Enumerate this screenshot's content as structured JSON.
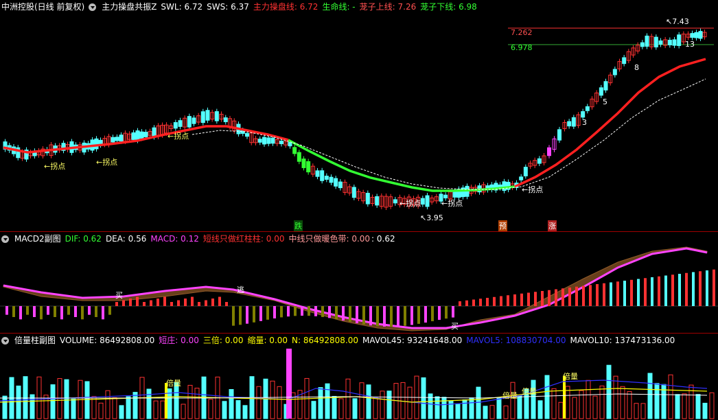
{
  "colors": {
    "up": "#ff3232",
    "down": "#54ffff",
    "ma": "#ff2020",
    "life_green": "#33ff33",
    "white": "#ffffff",
    "magenta": "#ff44ff",
    "yellow": "#ffff00",
    "cyan": "#54ffff",
    "blue": "#3030ff",
    "olive": "#808000"
  },
  "main": {
    "stock": "中洲控股(日线 前复权)",
    "indicator": "主力操盘共振Z",
    "swl": "SWL: 6.72",
    "sws": "SWS: 6.37",
    "zhuli": "主力操盘线: 6.72",
    "shengming": "生命线: -",
    "shangxian": "茏子上线: 7.26",
    "xiaxian": "茏子下线: 6.98",
    "line_up": "7.262",
    "line_down": "6.978",
    "high": "7.43",
    "low": "3.95",
    "count3": "3",
    "count5": "5",
    "count8": "8",
    "count13": "13",
    "guaidian": "拐点",
    "die": "跌",
    "yu": "预",
    "zhang": "涨"
  },
  "macd": {
    "title": "MACD2副图",
    "dif": "DIF: 0.62",
    "dea": "DEA: 0.56",
    "macd": "MACD: 0.12",
    "duan": "短线只做红柱柱: 0.00",
    "zhong": "中线只做暖色带: 0.00",
    "last": ": 0.62",
    "mai": "买",
    "tao": "逃"
  },
  "vol": {
    "title": "倍量柱副图",
    "volume": "VOLUME: 86492808.00",
    "duanzhuang": "短庄: 0.00",
    "sanbei": "三倍: 0.00",
    "suoliang": "缩量: 0.00",
    "n": "N: 86492808.00",
    "mavol45": "MAVOL45: 93241648.00",
    "mavol5": "MAVOL5: 108830704.00",
    "mavol10": "MAVOL10: 137473136.00",
    "beiliang": "倍量"
  }
}
